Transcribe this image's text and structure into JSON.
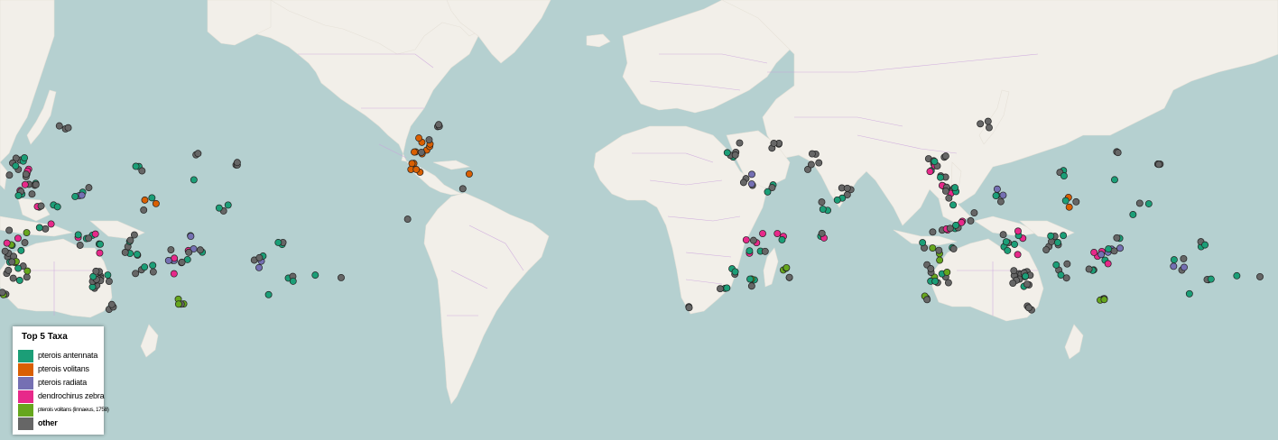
{
  "legend": {
    "title": "Top 5 Taxa",
    "items": [
      {
        "label": "pterois antennata",
        "color": "#1b9e77"
      },
      {
        "label": "pterois volitans",
        "color": "#d95f02"
      },
      {
        "label": "pterois radiata",
        "color": "#7570b3"
      },
      {
        "label": "dendrochirus zebra",
        "color": "#e7298a"
      },
      {
        "label": "pterois volitans (linnaeus, 1758)",
        "color": "#66a61e"
      },
      {
        "label": "other",
        "color": "#666666"
      }
    ]
  },
  "colors": {
    "ocean": "#b5d0d0",
    "land": "#f2efe9",
    "border": "#c9a0dc",
    "marker_stroke": "#222222"
  }
}
